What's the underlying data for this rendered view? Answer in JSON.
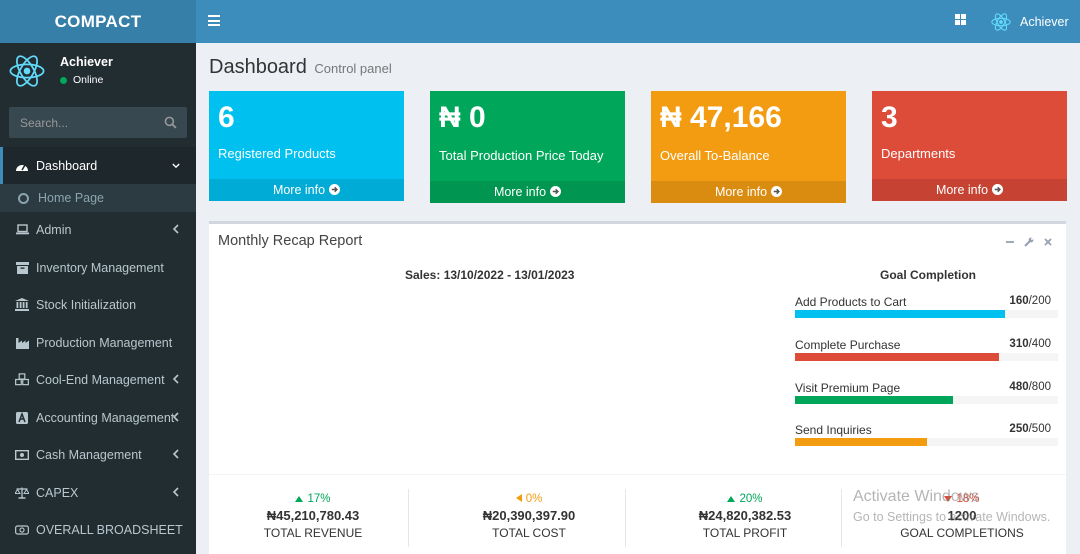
{
  "app": {
    "logo_text": "COMPACT",
    "username": "Achiever"
  },
  "sidebar": {
    "user_name": "Achiever",
    "user_status": "Online",
    "search_placeholder": "Search...",
    "items": [
      {
        "label": "Dashboard",
        "icon": "dashboard-icon",
        "has_chevron": true,
        "active": true
      },
      {
        "label": "Home Page",
        "icon": "circle-icon",
        "submenu": true
      },
      {
        "label": "Admin",
        "icon": "laptop-icon",
        "has_chevron": true
      },
      {
        "label": "Inventory Management",
        "icon": "archive-icon",
        "has_chevron": false
      },
      {
        "label": "Stock Initialization",
        "icon": "bank-icon",
        "has_chevron": false
      },
      {
        "label": "Production Management",
        "icon": "industry-icon",
        "has_chevron": false
      },
      {
        "label": "Cool-End Management",
        "icon": "cubes-icon",
        "has_chevron": true
      },
      {
        "label": "Accounting Management",
        "icon": "font-icon",
        "has_chevron": true
      },
      {
        "label": "Cash Management",
        "icon": "money-icon",
        "has_chevron": true
      },
      {
        "label": "CAPEX",
        "icon": "balance-scale-icon",
        "has_chevron": true
      },
      {
        "label": "OVERALL BROADSHEET",
        "icon": "money-bill-icon",
        "has_chevron": false
      }
    ]
  },
  "page": {
    "title": "Dashboard",
    "subtitle": "Control panel"
  },
  "stats": [
    {
      "value": "6",
      "label": "Registered Products",
      "link": "More info",
      "color": "#00c0ef"
    },
    {
      "value": "₦ 0",
      "label": "Total Production Price Today",
      "link": "More info",
      "color": "#00a65a"
    },
    {
      "value": "₦ 47,166",
      "label": "Overall To-Balance",
      "link": "More info",
      "color": "#f39c12"
    },
    {
      "value": "3",
      "label": "Departments",
      "link": "More info",
      "color": "#dd4b39"
    }
  ],
  "report": {
    "title": "Monthly Recap Report",
    "chart_caption": "Sales: 13/10/2022 - 13/01/2023",
    "goal_title": "Goal Completion",
    "goals": [
      {
        "label": "Add Products to Cart",
        "value": "160",
        "total": "/200",
        "fraction": 0.8,
        "color": "#00c0ef"
      },
      {
        "label": "Complete Purchase",
        "value": "310",
        "total": "/400",
        "fraction": 0.775,
        "color": "#dd4b39"
      },
      {
        "label": "Visit Premium Page",
        "value": "480",
        "total": "/800",
        "fraction": 0.6,
        "color": "#00a65a"
      },
      {
        "label": "Send Inquiries",
        "value": "250",
        "total": "/500",
        "fraction": 0.5,
        "color": "#f39c12"
      }
    ],
    "summary": [
      {
        "percent": "17%",
        "direction": "up",
        "color": "#00a65a",
        "amount": "₦45,210,780.43",
        "label": "TOTAL REVENUE"
      },
      {
        "percent": "0%",
        "direction": "left",
        "color": "#f39c12",
        "amount": "₦20,390,397.90",
        "label": "TOTAL COST"
      },
      {
        "percent": "20%",
        "direction": "up",
        "color": "#00a65a",
        "amount": "₦24,820,382.53",
        "label": "TOTAL PROFIT"
      },
      {
        "percent": "18%",
        "direction": "down",
        "color": "#dd4b39",
        "amount": "1200",
        "label": "GOAL COMPLETIONS"
      }
    ]
  },
  "watermark": {
    "line1": "Activate Windows",
    "line2": "Go to Settings to activate Windows."
  }
}
